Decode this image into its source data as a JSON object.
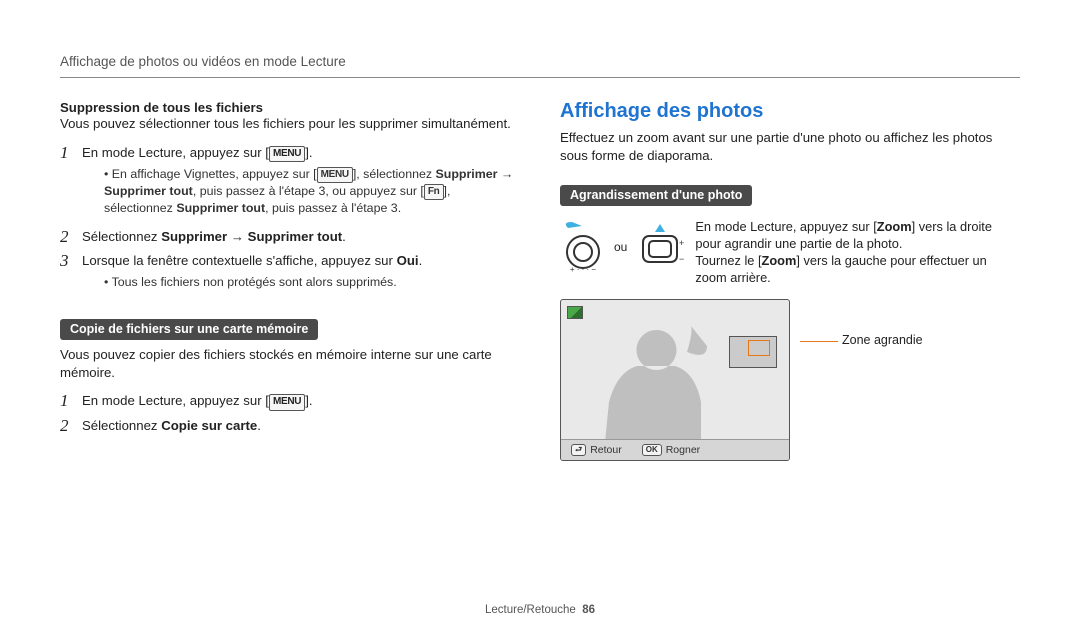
{
  "header": "Affichage de photos ou vidéos en mode Lecture",
  "left": {
    "suppr_title": "Suppression de tous les fichiers",
    "suppr_desc": "Vous pouvez sélectionner tous les fichiers pour les supprimer simultanément.",
    "steps1": {
      "s1_pre": "En mode Lecture, appuyez sur [",
      "s1_post": "].",
      "s1_sub_pre": "En affichage Vignettes, appuyez sur [",
      "s1_sub_mid1": "], sélectionnez ",
      "s1_sub_b1": "Supprimer",
      "s1_sub_arrow": " → ",
      "s1_sub_b2": "Supprimer tout",
      "s1_sub_mid2": ", puis passez à l'étape 3, ou appuyez sur [",
      "s1_sub_mid3": "], sélectionnez ",
      "s1_sub_b3": "Supprimer tout",
      "s1_sub_tail": ", puis passez à l'étape 3.",
      "s2_pre": "Sélectionnez ",
      "s2_b1": "Supprimer",
      "s2_arrow": " → ",
      "s2_b2": "Supprimer tout",
      "s2_post": ".",
      "s3_pre": "Lorsque la fenêtre contextuelle s'affiche, appuyez sur ",
      "s3_b": "Oui",
      "s3_post": ".",
      "s3_sub": "Tous les fichiers non protégés sont alors supprimés."
    },
    "copy_pill": "Copie de fichiers sur une carte mémoire",
    "copy_desc": "Vous pouvez copier des fichiers stockés en mémoire interne sur une carte mémoire.",
    "steps2": {
      "s1_pre": "En mode Lecture, appuyez sur [",
      "s1_post": "].",
      "s2_pre": "Sélectionnez ",
      "s2_b": "Copie sur carte",
      "s2_post": "."
    }
  },
  "right": {
    "title": "Affichage des photos",
    "desc": "Effectuez un zoom avant sur une partie d'une photo ou affichez les photos sous forme de diaporama.",
    "zoom_pill": "Agrandissement d'une photo",
    "ou": "ou",
    "zoom_text_l1_pre": "En mode Lecture, appuyez sur [",
    "zoom_text_l1_b": "Zoom",
    "zoom_text_l1_post": "] vers la droite pour agrandir une partie de la photo.",
    "zoom_text_l2_pre": "Tournez le [",
    "zoom_text_l2_b": "Zoom",
    "zoom_text_l2_post": "] vers la gauche pour effectuer un zoom arrière.",
    "legend": "Zone agrandie",
    "footer_back": "Retour",
    "footer_ok_key": "OK",
    "footer_crop": "Rogner"
  },
  "menu_label": "MENU",
  "fn_label": "Fn",
  "page_footer_section": "Lecture/Retouche",
  "page_footer_num": "86"
}
